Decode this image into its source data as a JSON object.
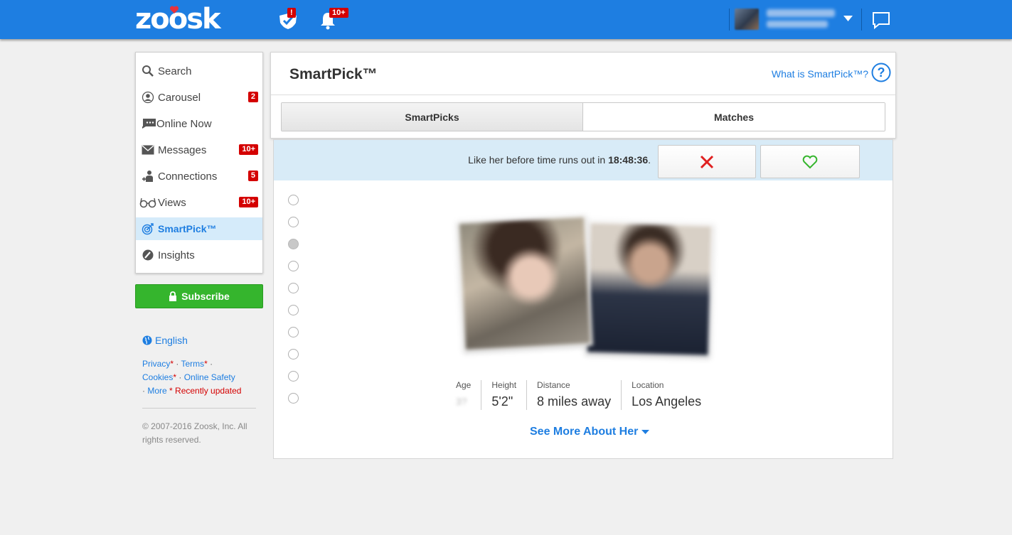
{
  "app": {
    "logo": "zoosk"
  },
  "topbar": {
    "checklist_badge": "!",
    "notifications_badge": "10+"
  },
  "sidebar": {
    "items": [
      {
        "label": "Search",
        "icon": "search-icon",
        "badge": ""
      },
      {
        "label": "Carousel",
        "icon": "carousel-icon",
        "badge": "2"
      },
      {
        "label": "Online Now",
        "icon": "chat-bubble-icon",
        "badge": ""
      },
      {
        "label": "Messages",
        "icon": "envelope-icon",
        "badge": "10+"
      },
      {
        "label": "Connections",
        "icon": "add-person-icon",
        "badge": "5"
      },
      {
        "label": "Views",
        "icon": "glasses-icon",
        "badge": "10+"
      },
      {
        "label": "SmartPick™",
        "icon": "target-icon",
        "badge": "",
        "active": true
      },
      {
        "label": "Insights",
        "icon": "gauge-icon",
        "badge": ""
      }
    ],
    "subscribe_label": "Subscribe",
    "language": "English",
    "footer": {
      "privacy": "Privacy",
      "terms": "Terms",
      "cookies": "Cookies",
      "online_safety": "Online Safety",
      "more": "More",
      "recently_updated": "* Recently updated",
      "copyright": "© 2007-2016 Zoosk, Inc. All rights reserved."
    }
  },
  "main": {
    "title": "SmartPick™",
    "help_link": "What is SmartPick™?",
    "tabs": [
      {
        "label": "SmartPicks",
        "active": true
      },
      {
        "label": "Matches",
        "active": false
      }
    ],
    "timer": {
      "prefix": "Like her before time runs out in ",
      "time": "18:48:36",
      "suffix": "."
    },
    "profile": {
      "stats": [
        {
          "label": "Age",
          "value": "3?"
        },
        {
          "label": "Height",
          "value": "5'2\""
        },
        {
          "label": "Distance",
          "value": "8 miles away"
        },
        {
          "label": "Location",
          "value": "Los Angeles"
        }
      ],
      "see_more": "See More About Her"
    },
    "pager": {
      "count": 10,
      "selected_index": 2
    }
  },
  "colors": {
    "brand_blue": "#1e7ee1",
    "badge_red": "#d40000",
    "subscribe_green": "#35b52d",
    "dislike_red": "#e02020",
    "like_green": "#35b52d"
  }
}
